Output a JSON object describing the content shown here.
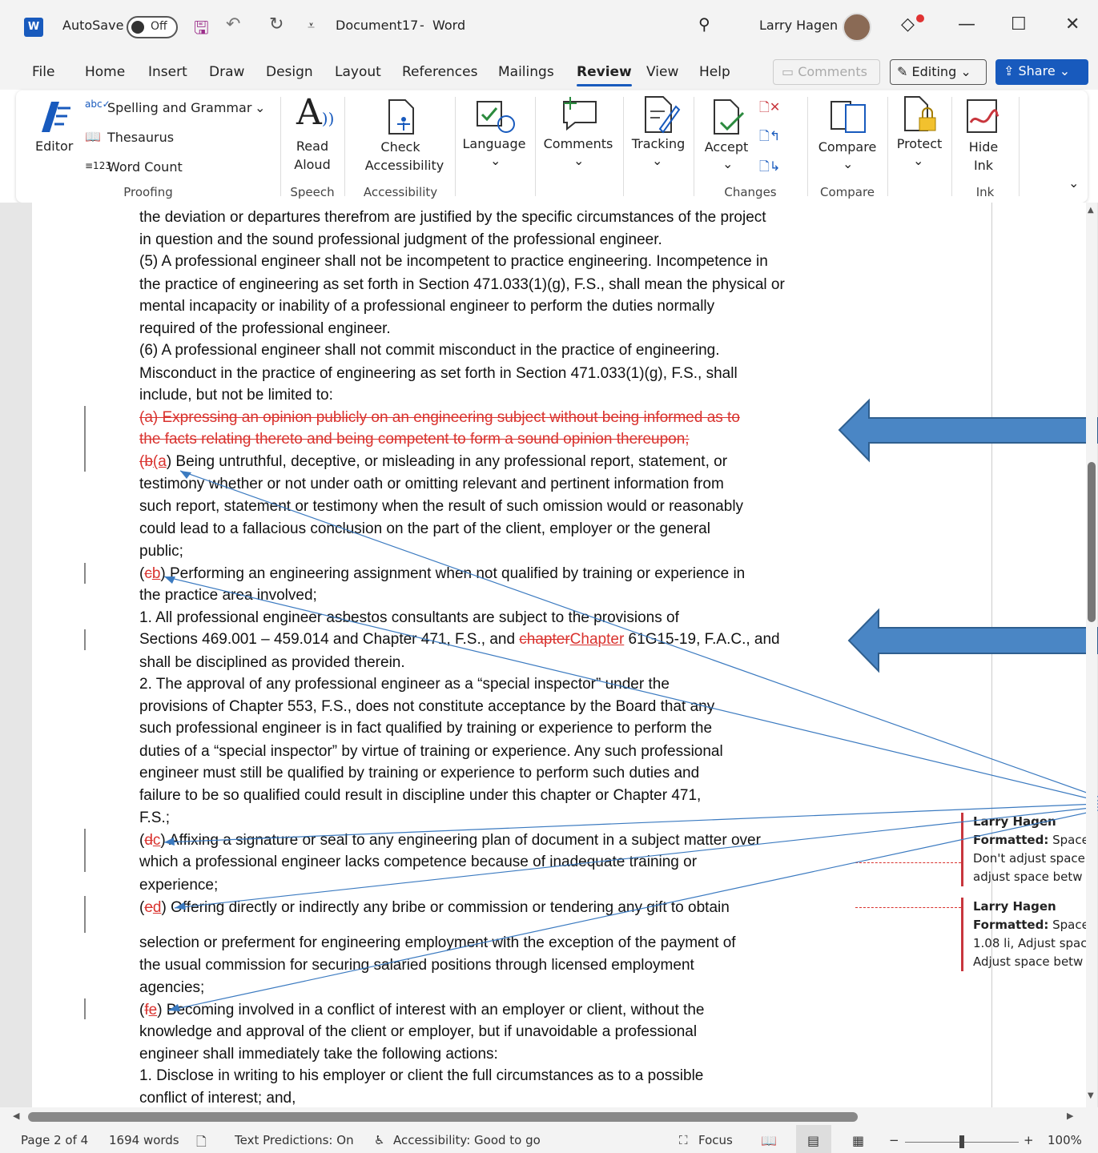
{
  "titlebar": {
    "autosave_label": "AutoSave",
    "autosave_state": "Off",
    "document_title": "Document17",
    "separator": "-",
    "app_name": "Word",
    "user_name": "Larry Hagen",
    "minimize": "—",
    "maximize": "☐",
    "close": "✕"
  },
  "menu": {
    "items": [
      "File",
      "Home",
      "Insert",
      "Draw",
      "Design",
      "Layout",
      "References",
      "Mailings",
      "Review",
      "View",
      "Help"
    ],
    "active": "Review",
    "comments_label": "Comments",
    "editing_label": "Editing",
    "share_label": "Share"
  },
  "ribbon": {
    "editor": "Editor",
    "spelling": "Spelling and Grammar",
    "thesaurus": "Thesaurus",
    "word_count": "Word Count",
    "read_aloud_1": "Read",
    "read_aloud_2": "Aloud",
    "check_1": "Check",
    "check_2": "Accessibility",
    "language": "Language",
    "comments": "Comments",
    "tracking": "Tracking",
    "accept": "Accept",
    "compare": "Compare",
    "protect": "Protect",
    "hide_ink_1": "Hide",
    "hide_ink_2": "Ink",
    "groups": {
      "proofing": "Proofing",
      "speech": "Speech",
      "accessibility": "Accessibility",
      "changes": "Changes",
      "compare": "Compare",
      "ink": "Ink"
    }
  },
  "document": {
    "l01": "the deviation or departures therefrom are justified by the specific circumstances of the project",
    "l02": "in question and the sound professional judgment of the professional engineer.",
    "l03": "(5) A professional engineer shall not be incompetent to practice engineering. Incompetence in",
    "l04": "the practice of engineering as set forth in Section 471.033(1)(g), F.S., shall mean the physical or",
    "l05": "mental incapacity or inability of a professional engineer to perform the duties normally",
    "l06": "required of the professional engineer.",
    "l07": "(6) A professional engineer shall not commit misconduct in the practice of engineering.",
    "l08": "Misconduct in the practice of engineering as set forth in Section 471.033(1)(g), F.S., shall",
    "l09": "include, but not be limited to:",
    "l10_del": "(a) Expressing an opinion publicly on an engineering subject without being informed as to",
    "l11_del": "the facts relating thereto and being competent to form a sound opinion thereupon;",
    "l12_open": "(",
    "l12_del": "b",
    "l12_ins": "(a",
    "l12_rest": ") Being untruthful, deceptive, or misleading in any professional report, statement, or",
    "l13": "testimony whether or not under oath or omitting relevant and pertinent information from",
    "l14": "such report, statement or testimony when the result of such omission would or reasonably",
    "l15": "could lead to a fallacious conclusion on the part of the client, employer or the general",
    "l16": "public;",
    "l17_open": "(",
    "l17_del": "c",
    "l17_ins": "b",
    "l17_rest": ") Performing an engineering assignment when not qualified by training or experience in",
    "l18": "the practice area involved;",
    "l19": "1. All professional engineer asbestos consultants are subject to the provisions of",
    "l20_a": "Sections 469.001 – 459.014 and Chapter 471, F.S., and ",
    "l20_del": "chapter",
    "l20_ins": "Chapter",
    "l20_b": " 61G15-19, F.A.C., and",
    "l21": "shall be disciplined as provided therein.",
    "l22": "2. The approval of any professional engineer as a “special inspector” under the",
    "l23": "provisions of Chapter 553, F.S., does not constitute acceptance by the Board that any",
    "l24": "such professional engineer is in fact qualified by training or experience to perform the",
    "l25": "duties of a “special inspector” by virtue of training or experience. Any such professional",
    "l26": "engineer must still be qualified by training or experience to perform such duties and",
    "l27": "failure to be so qualified could result in discipline under this chapter or Chapter 471,",
    "l28": "F.S.;",
    "l29_open": "(",
    "l29_del": "d",
    "l29_ins": "c",
    "l29_rest": ") Affixing a signature or seal to any engineering plan of document in a subject matter over",
    "l30": "which a professional engineer lacks competence because of inadequate training or",
    "l31": "experience;",
    "l32_open": "(",
    "l32_del": "e",
    "l32_ins": "d",
    "l32_rest": ") Offering directly or indirectly any bribe or commission or tendering any gift to obtain",
    "l33": "selection or preferment for engineering employment with the exception of the payment of",
    "l34": "the usual commission for securing salaried positions through licensed employment",
    "l35": "agencies;",
    "l36_open": "(",
    "l36_del": "f",
    "l36_ins": "e",
    "l36_rest": ") Becoming involved in a conflict of interest with an employer or client, without the",
    "l37": "knowledge and approval of the client or employer, but if unavoidable a professional",
    "l38": "engineer shall immediately take the following actions:",
    "l39": "1. Disclose in writing to his employer or client the full circumstances as to a possible",
    "l40": "conflict of interest; and,"
  },
  "balloons": [
    {
      "author": "Larry Hagen",
      "label": "Formatted:",
      "text1": " Space",
      "text2": "Don't adjust space",
      "text3": "adjust space betw"
    },
    {
      "author": "Larry Hagen",
      "label": "Formatted:",
      "text1": " Space",
      "text2": "1.08 li, Adjust spac",
      "text3": "Adjust space betw"
    }
  ],
  "status": {
    "page": "Page 2 of 4",
    "words": "1694 words",
    "predictions": "Text Predictions: On",
    "accessibility": "Accessibility: Good to go",
    "focus": "Focus",
    "zoom_minus": "−",
    "zoom_plus": "+",
    "zoom": "100%"
  },
  "colors": {
    "accent": "#185abd",
    "revision": "#d9322e",
    "arrow": "#4a86c5"
  }
}
